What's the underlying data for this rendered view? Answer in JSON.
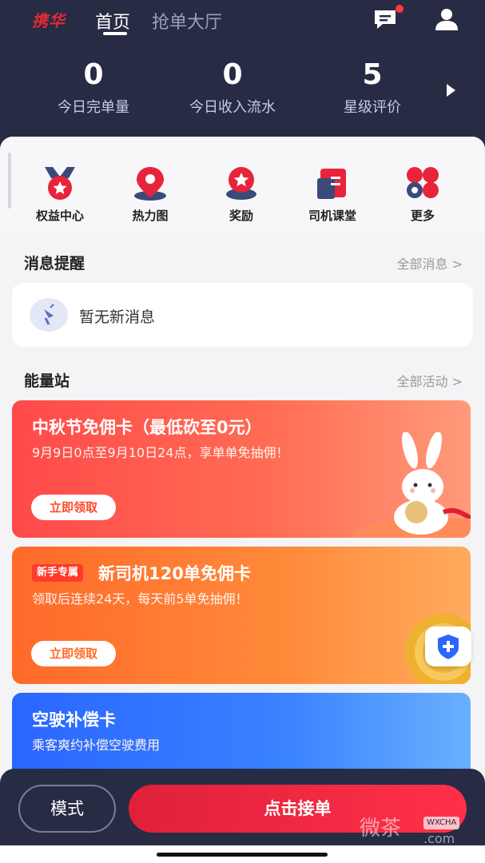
{
  "header": {
    "logo": "携华",
    "tabs": [
      {
        "label": "首页",
        "active": true
      },
      {
        "label": "抢单大厅",
        "active": false
      }
    ],
    "icons": [
      "message-icon",
      "user-icon"
    ]
  },
  "stats": [
    {
      "value": "0",
      "label": "今日完单量"
    },
    {
      "value": "0",
      "label": "今日收入流水"
    },
    {
      "value": "5",
      "label": "星级评价"
    }
  ],
  "quick_actions": [
    {
      "label": "权益中心",
      "icon": "rights-center-icon"
    },
    {
      "label": "热力图",
      "icon": "heatmap-icon"
    },
    {
      "label": "奖励",
      "icon": "reward-icon"
    },
    {
      "label": "司机课堂",
      "icon": "driver-class-icon"
    },
    {
      "label": "更多",
      "icon": "more-icon"
    }
  ],
  "messages": {
    "title": "消息提醒",
    "link": "全部消息 >",
    "empty_text": "暂无新消息"
  },
  "energy": {
    "title": "能量站",
    "link": "全部活动 >",
    "cards": [
      {
        "title": "中秋节免佣卡（最低砍至0元）",
        "subtitle": "9月9日0点至9月10日24点，享单单免抽佣！",
        "button": "立即领取"
      },
      {
        "badge": "新手专属",
        "title": "新司机120单免佣卡",
        "subtitle": "领取后连续24天，每天前5单免抽佣！",
        "button": "立即领取"
      },
      {
        "title": "空驶补偿卡",
        "subtitle": "乘客爽约补偿空驶费用"
      }
    ]
  },
  "bottom": {
    "mode_button": "模式",
    "accept_button": "点击接单"
  },
  "watermark": {
    "text": "微茶",
    "tag": "WXCHA",
    "domain": ".com"
  },
  "colors": {
    "header_bg": "#282b44",
    "accent_red": "#e0203a",
    "orange": "#ff7a3a",
    "blue": "#2a66ff"
  }
}
